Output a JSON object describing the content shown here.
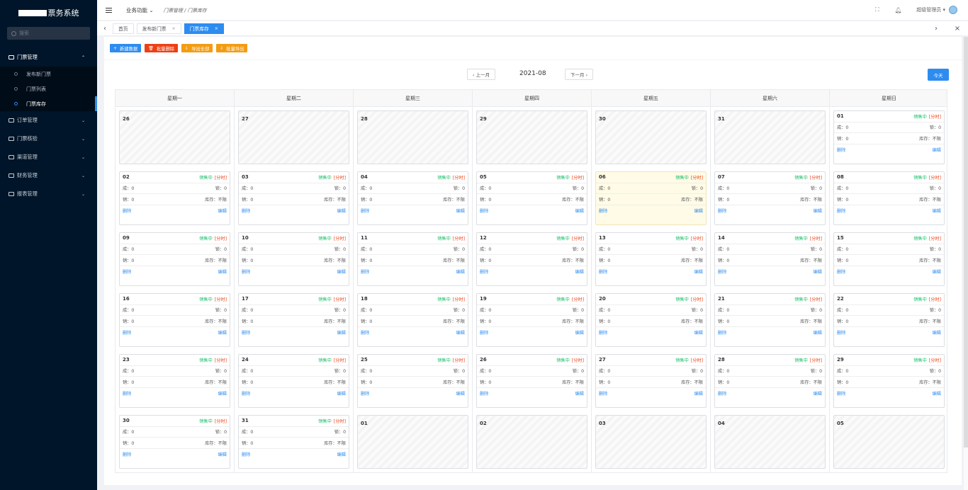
{
  "sidebar": {
    "logo_text": "票务系统",
    "search_placeholder": "搜索",
    "menus": [
      {
        "label": "门票管理",
        "open": true,
        "children": [
          {
            "label": "发布新门票",
            "active": false
          },
          {
            "label": "门票列表",
            "active": false
          },
          {
            "label": "门票库存",
            "active": true
          }
        ]
      },
      {
        "label": "订单管理"
      },
      {
        "label": "门票核验"
      },
      {
        "label": "渠道管理"
      },
      {
        "label": "财务管理"
      },
      {
        "label": "报表管理"
      }
    ]
  },
  "header": {
    "menu_label": "业务功能",
    "breadcrumb": "门票管理 / 门票库存",
    "user": "超级管理员"
  },
  "tabs": [
    {
      "label": "首页",
      "closable": false,
      "active": false
    },
    {
      "label": "发布新门票",
      "closable": true,
      "active": false
    },
    {
      "label": "门票库存",
      "closable": true,
      "active": true
    }
  ],
  "actions": [
    {
      "label": "新建数据",
      "color": "blue",
      "glyph": "+"
    },
    {
      "label": "批量删除",
      "color": "red",
      "glyph": "🗑"
    },
    {
      "label": "导出全部",
      "color": "orange",
      "glyph": "⇩"
    },
    {
      "label": "批量导出",
      "color": "orange",
      "glyph": "⇩"
    }
  ],
  "calendar": {
    "prev": "‹ 上一月",
    "next": "下一月 ›",
    "month": "2021-08",
    "today": "今天",
    "weekdays": [
      "星期一",
      "星期二",
      "星期三",
      "星期四",
      "星期五",
      "星期六",
      "星期日"
    ],
    "labels": {
      "status": "销售中",
      "time": "[分时]",
      "sold_prefix": "成：",
      "lock_prefix": "锁：",
      "sell_prefix": "销：",
      "stock": "库存：不限",
      "delete": "删除",
      "edit": "编辑"
    },
    "weeks": [
      [
        {
          "d": "26",
          "out": true
        },
        {
          "d": "27",
          "out": true
        },
        {
          "d": "28",
          "out": true
        },
        {
          "d": "29",
          "out": true
        },
        {
          "d": "30",
          "out": true
        },
        {
          "d": "31",
          "out": true
        },
        {
          "d": "01"
        }
      ],
      [
        {
          "d": "02"
        },
        {
          "d": "03"
        },
        {
          "d": "04"
        },
        {
          "d": "05"
        },
        {
          "d": "06",
          "today": true
        },
        {
          "d": "07"
        },
        {
          "d": "08"
        }
      ],
      [
        {
          "d": "09"
        },
        {
          "d": "10"
        },
        {
          "d": "11"
        },
        {
          "d": "12"
        },
        {
          "d": "13"
        },
        {
          "d": "14"
        },
        {
          "d": "15"
        }
      ],
      [
        {
          "d": "16"
        },
        {
          "d": "17"
        },
        {
          "d": "18"
        },
        {
          "d": "19"
        },
        {
          "d": "20"
        },
        {
          "d": "21"
        },
        {
          "d": "22"
        }
      ],
      [
        {
          "d": "23"
        },
        {
          "d": "24"
        },
        {
          "d": "25"
        },
        {
          "d": "26"
        },
        {
          "d": "27"
        },
        {
          "d": "28"
        },
        {
          "d": "29"
        }
      ],
      [
        {
          "d": "30"
        },
        {
          "d": "31"
        },
        {
          "d": "01",
          "out": true
        },
        {
          "d": "02",
          "out": true
        },
        {
          "d": "03",
          "out": true
        },
        {
          "d": "04",
          "out": true
        },
        {
          "d": "05",
          "out": true
        }
      ]
    ],
    "values": {
      "sold": "0",
      "lock": "0",
      "sell": "0"
    }
  },
  "colors": {
    "primary": "#2d8cf0",
    "danger": "#ed4014",
    "warning": "#f39c12",
    "success": "#19be6b",
    "sidebar": "#001529"
  }
}
